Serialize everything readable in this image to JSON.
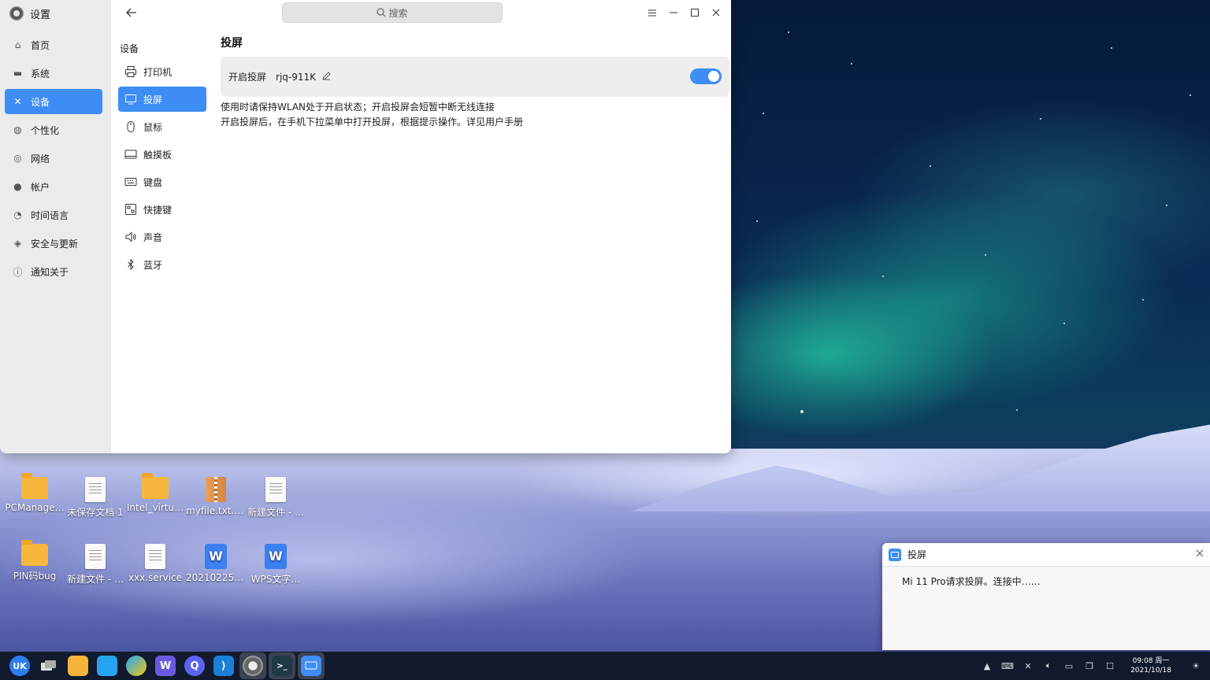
{
  "window": {
    "app_title": "设置",
    "search_placeholder": "搜索",
    "nav": [
      {
        "label": "首页",
        "icon": "home-icon"
      },
      {
        "label": "系统",
        "icon": "monitor-icon"
      },
      {
        "label": "设备",
        "icon": "device-icon",
        "active": true
      },
      {
        "label": "个性化",
        "icon": "palette-icon"
      },
      {
        "label": "网络",
        "icon": "globe-icon"
      },
      {
        "label": "帐户",
        "icon": "user-icon"
      },
      {
        "label": "时间语言",
        "icon": "clock-icon"
      },
      {
        "label": "安全与更新",
        "icon": "shield-icon"
      },
      {
        "label": "通知关于",
        "icon": "info-icon"
      }
    ],
    "sub_title": "设备",
    "sub_items": [
      {
        "label": "打印机",
        "icon": "printer-icon"
      },
      {
        "label": "投屏",
        "icon": "cast-icon",
        "active": true
      },
      {
        "label": "鼠标",
        "icon": "mouse-icon"
      },
      {
        "label": "触摸板",
        "icon": "touchpad-icon"
      },
      {
        "label": "键盘",
        "icon": "keyboard-icon"
      },
      {
        "label": "快捷键",
        "icon": "shortcut-icon"
      },
      {
        "label": "声音",
        "icon": "speaker-icon"
      },
      {
        "label": "蓝牙",
        "icon": "bluetooth-icon"
      }
    ],
    "content": {
      "title": "投屏",
      "row_label": "开启投屏",
      "device_name": "rjq-911K",
      "toggle_on": true,
      "desc_line1": "使用时请保持WLAN处于开启状态；开启投屏会短暂中断无线连接",
      "desc_line2": "开启投屏后，在手机下拉菜单中打开投屏，根据提示操作。详见用户手册"
    }
  },
  "desktop_icons": [
    {
      "label": "PCManage…",
      "kind": "folder"
    },
    {
      "label": "未保存文档 1",
      "kind": "doc"
    },
    {
      "label": "Intel_virtu…",
      "kind": "folder"
    },
    {
      "label": "myfile.txt.t…",
      "kind": "archive"
    },
    {
      "label": "新建文件 - …",
      "kind": "doc"
    },
    {
      "label": "PIN码bug",
      "kind": "folder"
    },
    {
      "label": "新建文件 - …",
      "kind": "doc"
    },
    {
      "label": "xxx.service",
      "kind": "doc"
    },
    {
      "label": "202102250…",
      "kind": "wps"
    },
    {
      "label": "WPS文字…",
      "kind": "wps"
    }
  ],
  "notification": {
    "title": "投屏",
    "message": "Mi 11 Pro请求投屏。连接中……"
  },
  "taskbar": {
    "time": "09:08 周一",
    "date": "2021/10/18"
  },
  "colors": {
    "accent": "#3d8df5",
    "nav_bg": "#ebebeb",
    "taskbar_bg": "#0c1424"
  }
}
